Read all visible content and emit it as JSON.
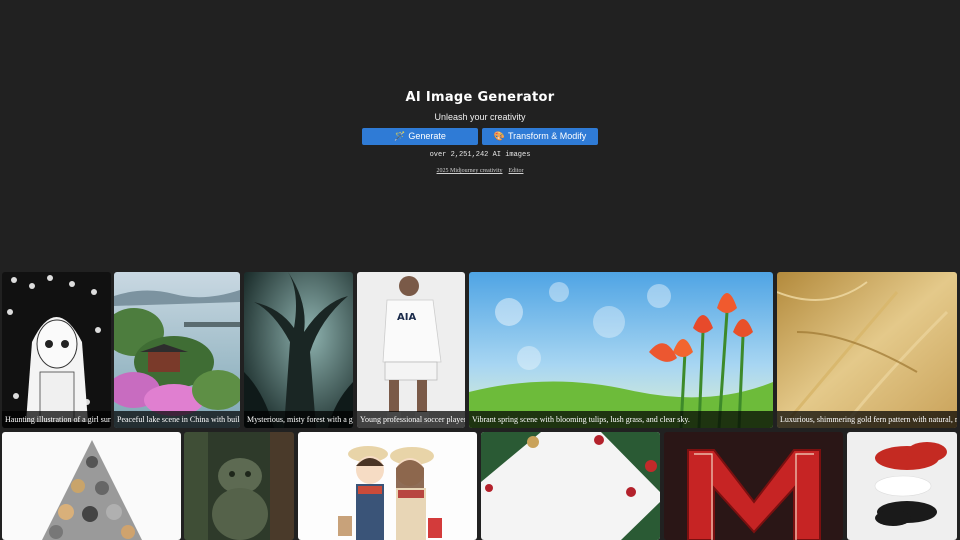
{
  "hero": {
    "title": "AI Image Generator",
    "subtitle": "Unleash your creativity",
    "generate_label": "Generate",
    "generate_icon": "wand-icon",
    "transform_label": "Transform & Modify",
    "transform_icon": "palette-icon",
    "counter": "over 2,251,242 AI images",
    "link_1": "2025 Midjourney creativity",
    "link_2": "Editor"
  },
  "colors": {
    "background": "#212121",
    "button": "#2f7bd6"
  },
  "gallery": {
    "row1": [
      {
        "caption": "Haunting illustration of a girl surrounded by cats"
      },
      {
        "caption": "Peaceful lake scene in China with buildings"
      },
      {
        "caption": "Mysterious, misty forest with a gnarled tree"
      },
      {
        "caption": "Young professional soccer player"
      },
      {
        "caption": "Vibrant spring scene with blooming tulips, lush grass, and clear sky."
      },
      {
        "caption": "Luxurious, shimmering gold fern pattern with natural, rich tones"
      }
    ]
  }
}
